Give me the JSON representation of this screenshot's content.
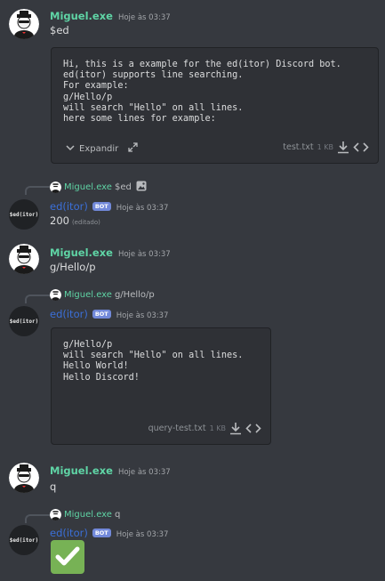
{
  "messages": [
    {
      "author": "Miguel.exe",
      "time": "Hoje às 03:37",
      "text": "$ed"
    },
    {
      "author": "Miguel.exe",
      "time": "Hoje às 03:37",
      "text": "g/Hello/p"
    },
    {
      "author": "Miguel.exe",
      "time": "Hoje às 03:37",
      "text": "q"
    }
  ],
  "file1": {
    "code": "Hi, this is a example for the ed(itor) Discord bot.\ned(itor) supports line searching.\nFor example:\ng/Hello/p\nwill search \"Hello\" on all lines.\nhere some lines for example:",
    "expand_label": "Expandir",
    "name": "test.txt",
    "size": "1 KB"
  },
  "bot_replies": [
    {
      "reply_author": "Miguel.exe",
      "reply_text": "$ed",
      "author": "ed(itor)",
      "badge": "BOT",
      "time": "Hoje às 03:37",
      "text": "200",
      "edited": "(editado)"
    },
    {
      "reply_author": "Miguel.exe",
      "reply_text": "g/Hello/p",
      "author": "ed(itor)",
      "badge": "BOT",
      "time": "Hoje às 03:37"
    },
    {
      "reply_author": "Miguel.exe",
      "reply_text": "q",
      "author": "ed(itor)",
      "badge": "BOT",
      "time": "Hoje às 03:37"
    }
  ],
  "file2": {
    "code": "g/Hello/p\nwill search \"Hello\" on all lines.\nHello World!\nHello Discord!",
    "name": "query-test.txt",
    "size": "1 KB"
  },
  "bot_avatar_label": "$ed(itor)",
  "colors": {
    "background": "#36393f",
    "user_name": "#5fd4a5",
    "bot_name": "#3b6fd8",
    "badge": "#7289da",
    "check": "#77b255"
  }
}
